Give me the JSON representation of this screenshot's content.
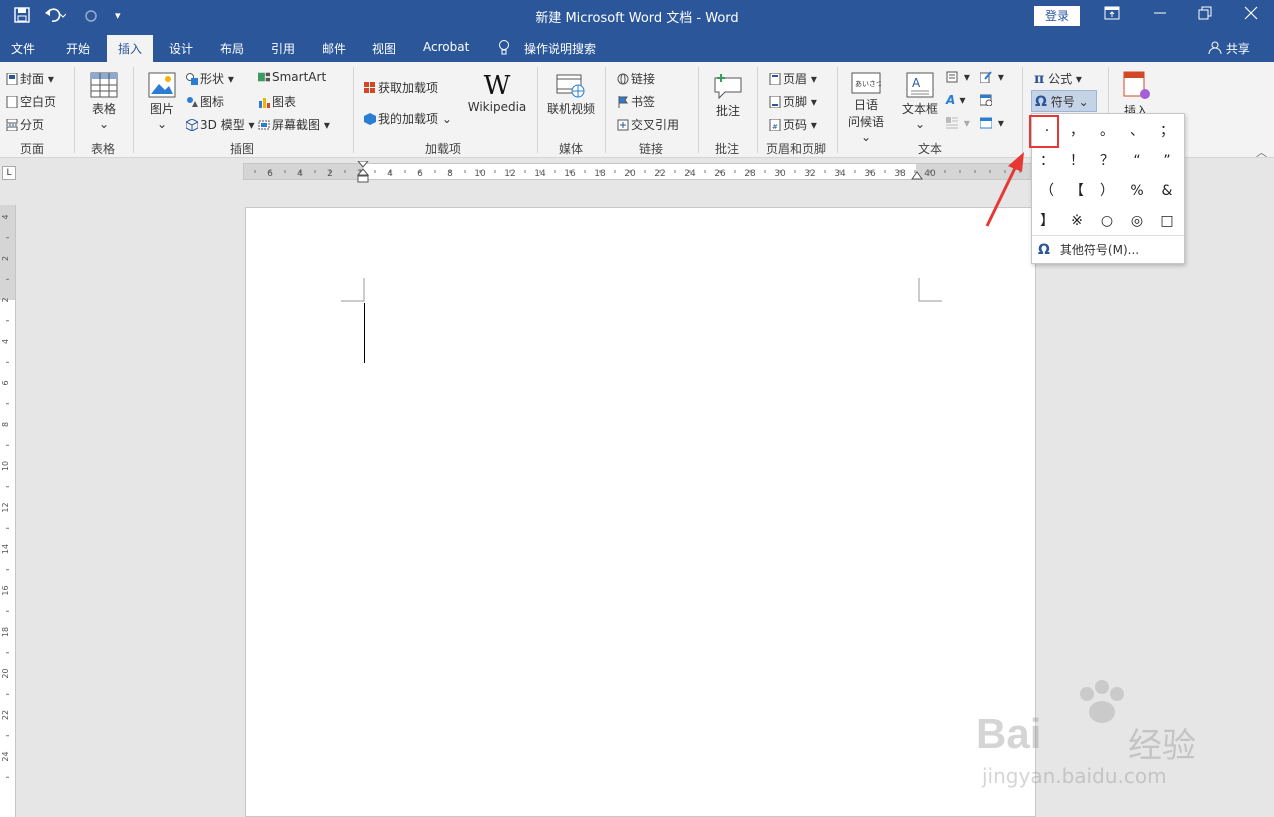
{
  "title": "新建 Microsoft Word 文档  -  Word",
  "login": "登录",
  "share": "共享",
  "tabs": [
    "文件",
    "开始",
    "插入",
    "设计",
    "布局",
    "引用",
    "邮件",
    "视图",
    "Acrobat"
  ],
  "tell_me": "操作说明搜索",
  "ribbon": {
    "pages": {
      "cover": "封面",
      "blank": "空白页",
      "break": "分页",
      "label": "页面"
    },
    "tables": {
      "table": "表格",
      "label": "表格"
    },
    "illustrations": {
      "picture": "图片",
      "shapes": "形状",
      "icons": "图标",
      "model3d": "3D 模型",
      "smartart": "SmartArt",
      "chart": "图表",
      "screenshot": "屏幕截图",
      "label": "插图"
    },
    "addins": {
      "get": "获取加载项",
      "mine": "我的加载项",
      "wiki": "Wikipedia",
      "label": "加载项"
    },
    "media": {
      "video": "联机视频",
      "label": "媒体"
    },
    "links": {
      "link": "链接",
      "bookmark": "书签",
      "xref": "交叉引用",
      "label": "链接"
    },
    "comments": {
      "comment": "批注",
      "label": "批注"
    },
    "headerfooter": {
      "header": "页眉",
      "footer": "页脚",
      "pagenum": "页码",
      "label": "页眉和页脚"
    },
    "text": {
      "jp1": "日语",
      "jp2": "问候语",
      "textbox": "文本框",
      "label": "文本"
    },
    "symbols": {
      "equation": "公式",
      "symbol": "符号",
      "insert": "插入"
    }
  },
  "symbol_grid": [
    [
      "·",
      "，",
      "。",
      "、",
      "；"
    ],
    [
      "：",
      "！",
      "？",
      "“",
      "”"
    ],
    [
      "（",
      "【",
      "）",
      "%",
      "&"
    ],
    [
      "】",
      "※",
      "○",
      "◎",
      "□"
    ]
  ],
  "more_symbols": "其他符号(M)...",
  "hruler_ticks": [
    "6",
    "4",
    "2",
    "2",
    "4",
    "6",
    "8",
    "10",
    "12",
    "14",
    "16",
    "18",
    "20",
    "22",
    "24",
    "26",
    "28",
    "30",
    "32",
    "34",
    "36",
    "38",
    "40"
  ],
  "vruler_ticks": [
    "4",
    "2",
    "2",
    "4",
    "6",
    "8",
    "10",
    "12",
    "14",
    "16",
    "18",
    "20",
    "22",
    "24"
  ],
  "watermark": {
    "brand": "Bai",
    "cn": "经验",
    "url": "jingyan.baidu.com"
  },
  "colors": {
    "brand": "#2b579a",
    "highlight": "#e53935",
    "ribbon": "#f3f3f3"
  }
}
